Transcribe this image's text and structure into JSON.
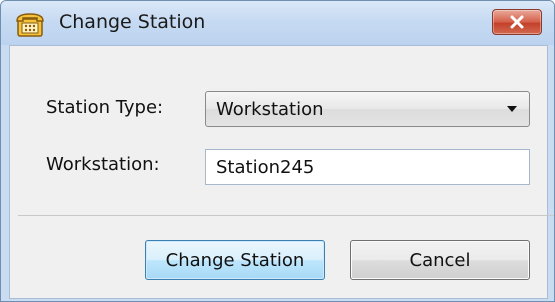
{
  "window": {
    "title": "Change Station",
    "icon": "telephone-icon",
    "close_icon": "close-icon"
  },
  "form": {
    "station_type_label": "Station Type:",
    "station_type_value": "Workstation",
    "workstation_label": "Workstation:",
    "workstation_value": "Station245"
  },
  "buttons": {
    "change_station_label": "Change Station",
    "cancel_label": "Cancel"
  },
  "colors": {
    "close_button": "#d5604a",
    "titlebar": "#c6daf2",
    "primary_button": "#bee6fd",
    "icon_accent": "#f3c43a"
  }
}
